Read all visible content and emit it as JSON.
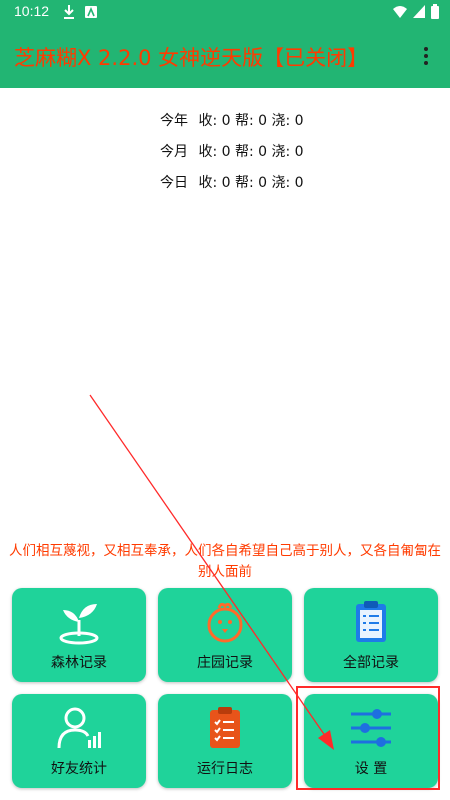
{
  "status_bar": {
    "time": "10:12"
  },
  "app_bar": {
    "title": "芝麻糊X 2.2.0 女神逆天版【已关闭】"
  },
  "stats": [
    {
      "period": "今年",
      "text": "收: 0 帮: 0 浇: 0"
    },
    {
      "period": "今月",
      "text": "收: 0 帮: 0 浇: 0"
    },
    {
      "period": "今日",
      "text": "收: 0 帮: 0 浇: 0"
    }
  ],
  "quote": "人们相互蔑视，又相互奉承，人们各自希望自己高于别人，又各自匍匐在别人面前",
  "buttons": [
    {
      "label": "森林记录",
      "icon": "sprout-icon"
    },
    {
      "label": "庄园记录",
      "icon": "chick-icon"
    },
    {
      "label": "全部记录",
      "icon": "clipboard-icon"
    },
    {
      "label": "好友统计",
      "icon": "user-stats-icon"
    },
    {
      "label": "运行日志",
      "icon": "log-icon"
    },
    {
      "label": "设 置",
      "icon": "sliders-icon"
    }
  ],
  "colors": {
    "primary": "#22b573",
    "tile": "#1fd39a",
    "title_text": "#ff3b00",
    "annotation": "#ff2a2a"
  }
}
